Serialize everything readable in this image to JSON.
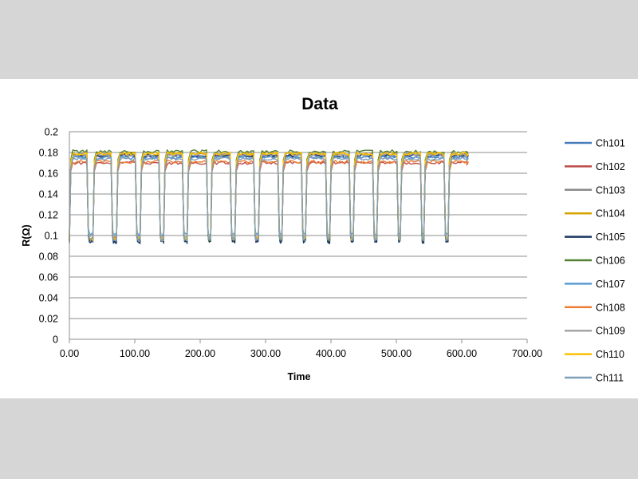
{
  "chart_data": {
    "type": "line",
    "title": "Data",
    "xlabel": "Time",
    "ylabel": "R(Ω)",
    "xlim": [
      0,
      700
    ],
    "ylim": [
      0,
      0.2
    ],
    "x_ticks": [
      "0.00",
      "100.00",
      "200.00",
      "300.00",
      "400.00",
      "500.00",
      "600.00",
      "700.00"
    ],
    "y_ticks": [
      "0",
      "0.02",
      "0.04",
      "0.06",
      "0.08",
      "0.1",
      "0.12",
      "0.14",
      "0.16",
      "0.18",
      "0.2"
    ],
    "grid": "horizontal",
    "legend_position": "right",
    "x_range_of_data": [
      0,
      610
    ],
    "cycle_period": 36,
    "cycles": [
      {
        "high_start": 0,
        "high_end": 29
      },
      {
        "high_start": 36,
        "high_end": 66
      },
      {
        "high_start": 72,
        "high_end": 103
      },
      {
        "high_start": 108,
        "high_end": 139
      },
      {
        "high_start": 144,
        "high_end": 175
      },
      {
        "high_start": 180,
        "high_end": 212
      },
      {
        "high_start": 216,
        "high_end": 248
      },
      {
        "high_start": 253,
        "high_end": 284
      },
      {
        "high_start": 289,
        "high_end": 321
      },
      {
        "high_start": 325,
        "high_end": 357
      },
      {
        "high_start": 361,
        "high_end": 394
      },
      {
        "high_start": 398,
        "high_end": 430
      },
      {
        "high_start": 434,
        "high_end": 466
      },
      {
        "high_start": 470,
        "high_end": 503
      },
      {
        "high_start": 506,
        "high_end": 539
      },
      {
        "high_start": 542,
        "high_end": 575
      },
      {
        "high_start": 579,
        "high_end": 610
      }
    ],
    "series": [
      {
        "name": "Ch101",
        "color": "#4a7ebb",
        "high": 0.176,
        "low": 0.095
      },
      {
        "name": "Ch102",
        "color": "#be4b48",
        "high": 0.17,
        "low": 0.097
      },
      {
        "name": "Ch103",
        "color": "#8a8a8a",
        "high": 0.178,
        "low": 0.096
      },
      {
        "name": "Ch104",
        "color": "#d6a500",
        "high": 0.179,
        "low": 0.097
      },
      {
        "name": "Ch105",
        "color": "#1f3864",
        "high": 0.177,
        "low": 0.094
      },
      {
        "name": "Ch106",
        "color": "#548235",
        "high": 0.181,
        "low": 0.096
      },
      {
        "name": "Ch107",
        "color": "#5b9bd5",
        "high": 0.175,
        "low": 0.101
      },
      {
        "name": "Ch108",
        "color": "#ed7d31",
        "high": 0.171,
        "low": 0.098
      },
      {
        "name": "Ch109",
        "color": "#a5a5a5",
        "high": 0.178,
        "low": 0.099
      },
      {
        "name": "Ch110",
        "color": "#ffc000",
        "high": 0.179,
        "low": 0.097
      },
      {
        "name": "Ch111",
        "color": "#7f9fb8",
        "high": 0.174,
        "low": 0.096
      }
    ]
  }
}
